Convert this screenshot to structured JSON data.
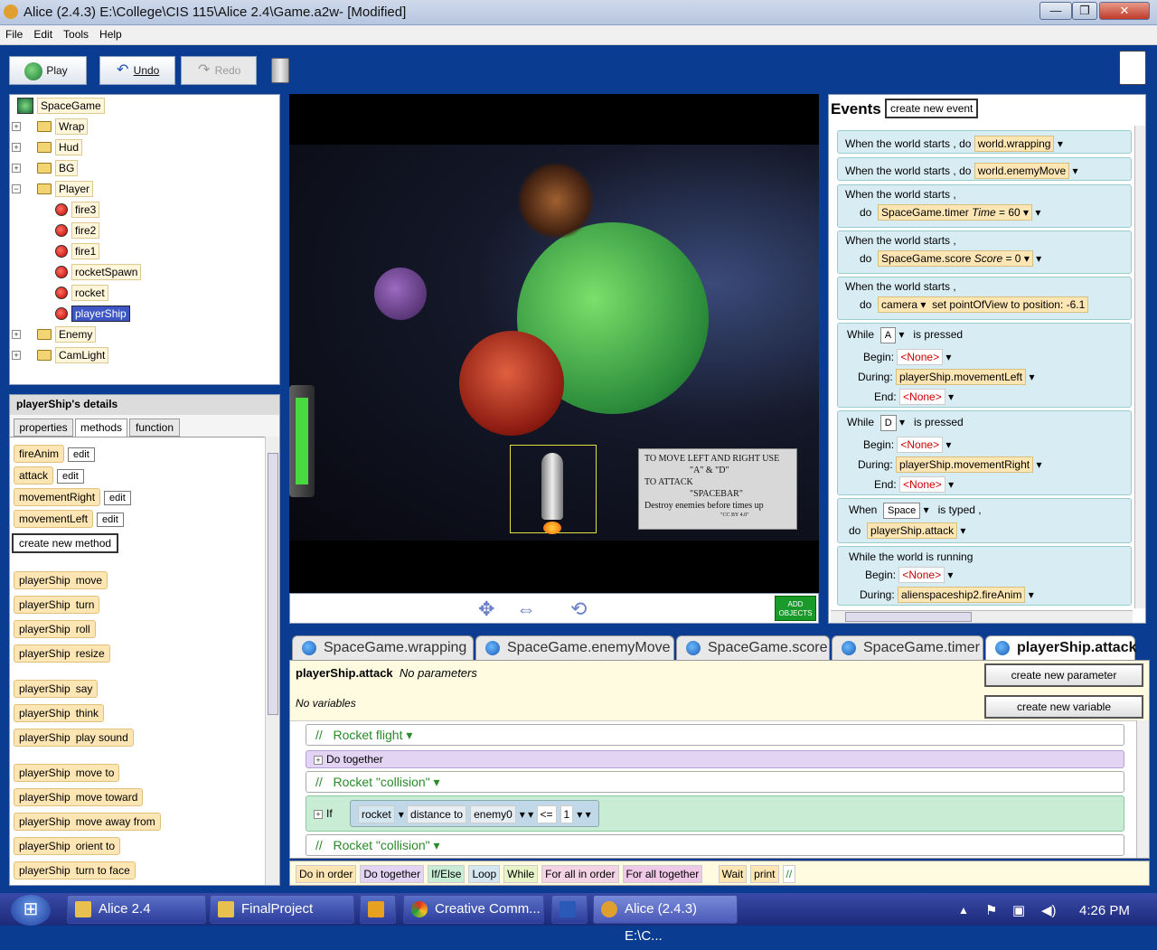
{
  "window": {
    "title": "Alice (2.4.3) E:\\College\\CIS 115\\Alice 2.4\\Game.a2w-  [Modified]",
    "minimize": "—",
    "restore": "❐",
    "close": "✕"
  },
  "menu": [
    "File",
    "Edit",
    "Tools",
    "Help"
  ],
  "toolbar": {
    "play": "Play",
    "undo": "Undo",
    "redo": "Redo"
  },
  "tree": {
    "root": "SpaceGame",
    "items": [
      "Wrap",
      "Hud",
      "BG",
      "Player",
      "fire3",
      "fire2",
      "fire1",
      "rocketSpawn",
      "rocket",
      "playerShip",
      "Enemy",
      "CamLight"
    ]
  },
  "details": {
    "title": "playerShip's details",
    "tabs": [
      "properties",
      "methods",
      "function"
    ],
    "methods": [
      "fireAnim",
      "attack",
      "movementRight",
      "movementLeft"
    ],
    "edit": "edit",
    "create_method": "create new method",
    "builtins": [
      {
        "obj": "playerShip",
        "verb": "move"
      },
      {
        "obj": "playerShip",
        "verb": "turn"
      },
      {
        "obj": "playerShip",
        "verb": "roll"
      },
      {
        "obj": "playerShip",
        "verb": "resize"
      },
      {
        "obj": "playerShip",
        "verb": "say"
      },
      {
        "obj": "playerShip",
        "verb": "think"
      },
      {
        "obj": "playerShip",
        "verb": "play sound"
      },
      {
        "obj": "playerShip",
        "verb": "move to"
      },
      {
        "obj": "playerShip",
        "verb": "move   toward"
      },
      {
        "obj": "playerShip",
        "verb": "move   away from"
      },
      {
        "obj": "playerShip",
        "verb": "orient to"
      },
      {
        "obj": "playerShip",
        "verb": "turn to face"
      }
    ]
  },
  "scene": {
    "info_lines": [
      "TO MOVE LEFT AND RIGHT USE",
      "\"A\" & \"D\"",
      "TO ATTACK",
      "\"SPACEBAR\"",
      "Destroy enemies before times up"
    ],
    "cc": "\"CC BY 4.0\"",
    "add_objects": "ADD OBJECTS"
  },
  "events": {
    "title": "Events",
    "create": "create new event",
    "world_starts": "When the world starts ,",
    "do": "do",
    "world_wrapping": "world.wrapping",
    "world_enemyMove": "world.enemyMove",
    "timer": "SpaceGame.timer",
    "timer_param": "Time",
    "timer_val": "= 60",
    "score": "SpaceGame.score",
    "score_param": "Score",
    "score_val": "= 0",
    "camera": "camera",
    "pov": "set  pointOfView  to",
    "position": "position: -6.1",
    "while": "While",
    "is_pressed": "is pressed",
    "key_a": "A",
    "key_d": "D",
    "begin": "Begin:",
    "during": "During:",
    "end": "End:",
    "none": "<None>",
    "left": "playerShip.movementLeft",
    "right": "playerShip.movementRight",
    "when": "When",
    "space": "Space",
    "is_typed": "is typed ,",
    "attack": "playerShip.attack",
    "while_running": "While the world is running",
    "fireanim": "alienspaceship2.fireAnim"
  },
  "editor": {
    "tabs": [
      "SpaceGame.wrapping",
      "SpaceGame.enemyMove",
      "SpaceGame.score",
      "SpaceGame.timer",
      "playerShip.attack"
    ],
    "method": "playerShip.attack",
    "no_params": "No parameters",
    "no_vars": "No variables",
    "create_param": "create new parameter",
    "create_var": "create new variable",
    "comment_slash": "//",
    "c1": "Rocket flight",
    "do_together": "Do together",
    "c2": "Rocket \"collision\"",
    "if": "If",
    "rocket": "rocket",
    "distance": "distance to",
    "enemy": "enemy0",
    "le": "<=",
    "one": "1",
    "c3": "Rocket \"collision\""
  },
  "blocks": [
    "Do in order",
    "Do together",
    "If/Else",
    "Loop",
    "While",
    "For all in order",
    "For all together",
    "Wait",
    "print",
    "//"
  ],
  "taskbar": {
    "start": "⊞",
    "items": [
      "Alice 2.4",
      "FinalProject",
      "",
      "Creative Comm...",
      "",
      "Alice (2.4.3) E:\\C..."
    ],
    "time": "4:26 PM"
  }
}
